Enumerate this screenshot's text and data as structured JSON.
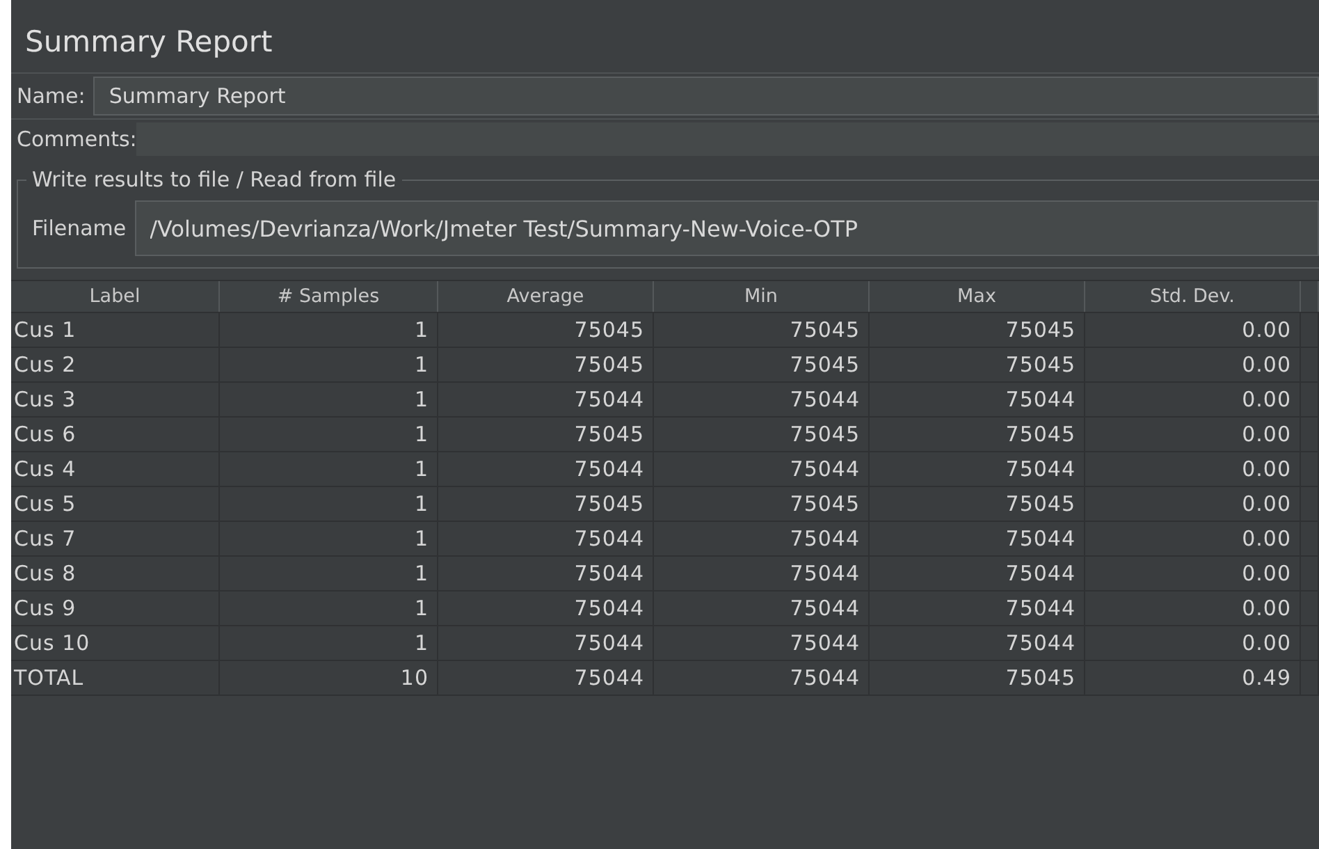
{
  "panel": {
    "title": "Summary Report"
  },
  "name_field": {
    "label": "Name:",
    "value": "Summary Report"
  },
  "comments_field": {
    "label": "Comments:"
  },
  "file_group": {
    "legend": "Write results to file / Read from file",
    "label": "Filename",
    "value": "/Volumes/Devrianza/Work/Jmeter Test/Summary-New-Voice-OTP"
  },
  "table": {
    "columns": [
      "Label",
      "# Samples",
      "Average",
      "Min",
      "Max",
      "Std. Dev."
    ],
    "rows": [
      [
        "Cus 1",
        "1",
        "75045",
        "75045",
        "75045",
        "0.00"
      ],
      [
        "Cus 2",
        "1",
        "75045",
        "75045",
        "75045",
        "0.00"
      ],
      [
        "Cus 3",
        "1",
        "75044",
        "75044",
        "75044",
        "0.00"
      ],
      [
        "Cus 6",
        "1",
        "75045",
        "75045",
        "75045",
        "0.00"
      ],
      [
        "Cus 4",
        "1",
        "75044",
        "75044",
        "75044",
        "0.00"
      ],
      [
        "Cus 5",
        "1",
        "75045",
        "75045",
        "75045",
        "0.00"
      ],
      [
        "Cus 7",
        "1",
        "75044",
        "75044",
        "75044",
        "0.00"
      ],
      [
        "Cus 8",
        "1",
        "75044",
        "75044",
        "75044",
        "0.00"
      ],
      [
        "Cus 9",
        "1",
        "75044",
        "75044",
        "75044",
        "0.00"
      ],
      [
        "Cus 10",
        "1",
        "75044",
        "75044",
        "75044",
        "0.00"
      ],
      [
        "TOTAL",
        "10",
        "75044",
        "75044",
        "75045",
        "0.49"
      ]
    ]
  }
}
